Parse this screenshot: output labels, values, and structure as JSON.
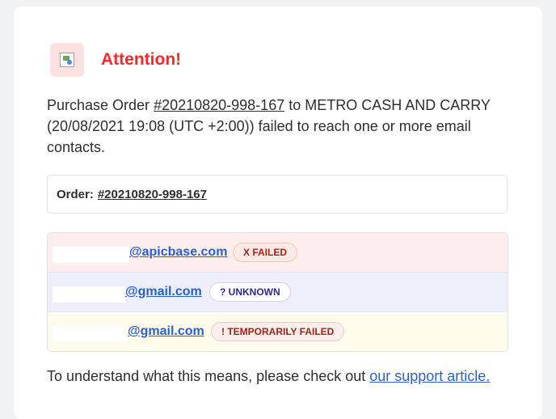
{
  "header": {
    "title": "Attention!",
    "icon": "broken-image-icon"
  },
  "message": {
    "prefix": "Purchase Order ",
    "order_link": "#20210820-998-167",
    "suffix": " to METRO CASH AND CARRY (20/08/2021 19:08 (UTC +2:00)) failed to reach one or more email contacts."
  },
  "order_box": {
    "label": "Order:",
    "number": "#20210820-998-167"
  },
  "contacts": [
    {
      "email": "@apicbase.com",
      "status": "X FAILED"
    },
    {
      "email": "@gmail.com",
      "status": "? UNKNOWN"
    },
    {
      "email": "@gmail.com",
      "status": "! TEMPORARILY FAILED"
    }
  ],
  "footer": {
    "text": "To understand what this means, please check out ",
    "link": "our support article."
  },
  "colors": {
    "attention": "#ee2b2b",
    "link": "#2b5fc9",
    "failed_bg": "#fdeeee",
    "unknown_bg": "#eeeefb",
    "temp_bg": "#fdfbea"
  }
}
